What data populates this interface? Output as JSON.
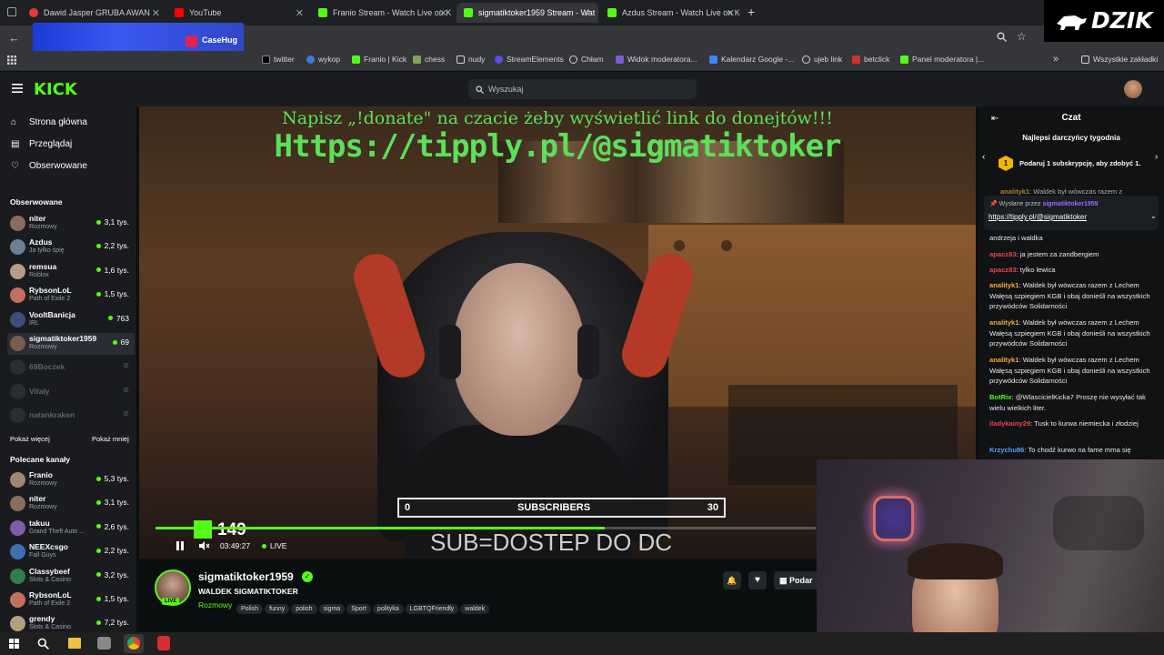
{
  "browser": {
    "tabs": [
      {
        "title": "Dawid Jasper GRUBA AWAN",
        "color": "#e53935"
      },
      {
        "title": "YouTube",
        "color": "#ff0000"
      },
      {
        "title": "Franio Stream - Watch Live on K",
        "color": "#53fc18"
      },
      {
        "title": "sigmatiktoker1959 Stream - Wat",
        "color": "#53fc18",
        "active": true
      },
      {
        "title": "Azdus Stream - Watch Live on K",
        "color": "#53fc18"
      }
    ],
    "new_tab": "+",
    "bookmarks": [
      {
        "label": "twitter",
        "color": "#ffffff"
      },
      {
        "label": "wykop",
        "color": "#3b7ddd"
      },
      {
        "label": "Franio | Kick",
        "color": "#53fc18"
      },
      {
        "label": "chess",
        "color": "#7fa650"
      },
      {
        "label": "nudy",
        "color": "#9aa0a6"
      },
      {
        "label": "StreamElements",
        "color": "#5c4ee5"
      },
      {
        "label": "Chłam",
        "color": "#9aa0a6"
      },
      {
        "label": "Widok moderatora...",
        "color": "#7b5cd6"
      },
      {
        "label": "Kalendarz Google -...",
        "color": "#4285f4"
      },
      {
        "label": "ujeb link",
        "color": "#9aa0a6"
      },
      {
        "label": "betclick",
        "color": "#d32f2f"
      },
      {
        "label": "Panel moderatora |...",
        "color": "#53fc18"
      }
    ],
    "all_bookmarks": "Wszystkie zakładki",
    "overlay_logo": "DZIK",
    "casehug": "CaseHug"
  },
  "kick": {
    "logo": "KICK",
    "search_placeholder": "Wyszukaj",
    "nav": [
      {
        "label": "Strona główna",
        "icon": "compass-icon"
      },
      {
        "label": "Przeglądaj",
        "icon": "browse-icon"
      },
      {
        "label": "Obserwowane",
        "icon": "heart-icon"
      }
    ],
    "followed_title": "Obserwowane",
    "followed": [
      {
        "name": "niter",
        "category": "Rozmowy",
        "viewers": "3,1 tys.",
        "avatar": "#8a6d5c"
      },
      {
        "name": "Azdus",
        "category": "Ja tylko śpię",
        "viewers": "2,2 tys.",
        "avatar": "#6d7f94"
      },
      {
        "name": "remsua",
        "category": "Roblox",
        "viewers": "1,6 tys.",
        "avatar": "#b79c86"
      },
      {
        "name": "RybsonLoL",
        "category": "Path of Exile 2",
        "viewers": "1,5 tys.",
        "avatar": "#c0705c"
      },
      {
        "name": "VooltBanicja",
        "category": "IRL",
        "viewers": "763",
        "avatar": "#3b4f7a"
      },
      {
        "name": "sigmatiktoker1959",
        "category": "Rozmowy",
        "viewers": "69",
        "avatar": "#7a5c4a",
        "selected": true
      },
      {
        "name": "69Boczek",
        "category": "",
        "viewers": "",
        "avatar": "#4a4f56",
        "offline": true
      },
      {
        "name": "Vitaly",
        "category": "",
        "viewers": "",
        "avatar": "#4a4f56",
        "offline": true
      },
      {
        "name": "natankraken",
        "category": "",
        "viewers": "",
        "avatar": "#4a4f56",
        "offline": true
      }
    ],
    "show_more": "Pokaż więcej",
    "show_less": "Pokaż mniej",
    "recommended_title": "Polecane kanały",
    "recommended": [
      {
        "name": "Franio",
        "category": "Rozmowy",
        "viewers": "5,3 tys.",
        "avatar": "#a2866e"
      },
      {
        "name": "niter",
        "category": "Rozmowy",
        "viewers": "3,1 tys.",
        "avatar": "#8a6d5c"
      },
      {
        "name": "takuu",
        "category": "Grand Theft Auto ...",
        "viewers": "2,6 tys.",
        "avatar": "#7d5ca8"
      },
      {
        "name": "NEEXcsgo",
        "category": "Fall Guys",
        "viewers": "2,2 tys.",
        "avatar": "#3e6fb0"
      },
      {
        "name": "Classybeef",
        "category": "Slots & Casino",
        "viewers": "3,2 tys.",
        "avatar": "#2f7d4a"
      },
      {
        "name": "RybsonLoL",
        "category": "Path of Exile 2",
        "viewers": "1,5 tys.",
        "avatar": "#c0705c"
      },
      {
        "name": "grendy",
        "category": "Slots & Casino",
        "viewers": "7,2 tys.",
        "avatar": "#b0a080"
      }
    ]
  },
  "video": {
    "banner_line1": "Napisz „!donate\" na czacie żeby wyświetlić link do donejtów!!!",
    "banner_line2": "Https://tipply.pl/@sigmatiktoker",
    "subs_min": "0",
    "subs_label": "SUBSCRIBERS",
    "subs_max": "30",
    "sub_text": "SUB=DOSTEP DO DC",
    "kick_count": "149",
    "time": "03:49:27",
    "live": "LIVE",
    "progress": 0.68
  },
  "channel": {
    "name": "sigmatiktoker1959",
    "title": "WALDEK SIGMATIKTOKER",
    "category": "Rozmowy",
    "tags": [
      "Polish",
      "funny",
      "polish",
      "sigma",
      "Sport",
      "polityka",
      "LGBTQFriendly",
      "waldek"
    ],
    "live_badge": "LIVE",
    "gift_label": "Podar"
  },
  "chat": {
    "title": "Czat",
    "top_gifters": "Najlepsi darczyńcy tygodnia",
    "gift_count": "1",
    "gift_prompt": "Podaruj 1 subskrypcję, aby zdobyć 1.",
    "pinned_preview_user": "analityk1",
    "pinned_preview": "Waldek był wówczas razem z",
    "pinned_by": "Wysłane przez",
    "pinned_user": "sigmatiktoker1959",
    "pinned_link": "https://tipply.pl/@sigmatiktoker",
    "messages": [
      {
        "user": "",
        "color": "#e9e9e9",
        "text": "andrzeja i waldka"
      },
      {
        "user": "apacz83",
        "color": "#e5484d",
        "text": "ja jestem za zandbergiem"
      },
      {
        "user": "apacz83",
        "color": "#e5484d",
        "text": "tylko lewica"
      },
      {
        "user": "analityk1",
        "color": "#f2a93b",
        "text": "Waldek był wówczas razem z Lechem Wałęsą szpiegiem KGB i obaj donieśli na wszystkich przywódców Solidarności"
      },
      {
        "user": "analityk1",
        "color": "#f2a93b",
        "text": "Waldek był wówczas razem z Lechem Wałęsą szpiegiem KGB i obaj donieśli na wszystkich przywódców Solidarności"
      },
      {
        "user": "analityk1",
        "color": "#f2a93b",
        "text": "Waldek był wówczas razem z Lechem Wałęsą szpiegiem KGB i obaj donieśli na wszystkich przywódców Solidarności"
      },
      {
        "user": "BotRix",
        "color": "#53fc18",
        "text": "@WlascicielKicka7 Proszę nie wysyłać tak wielu wielkich liter."
      },
      {
        "user": "iladykainy29",
        "color": "#e5484d",
        "text": "Tusk to kurwa niemiecka i złodziej"
      },
      {
        "user": "Krzychu86",
        "color": "#4fa3ff",
        "text": "To chodź kurwo na fame mma się"
      }
    ]
  }
}
